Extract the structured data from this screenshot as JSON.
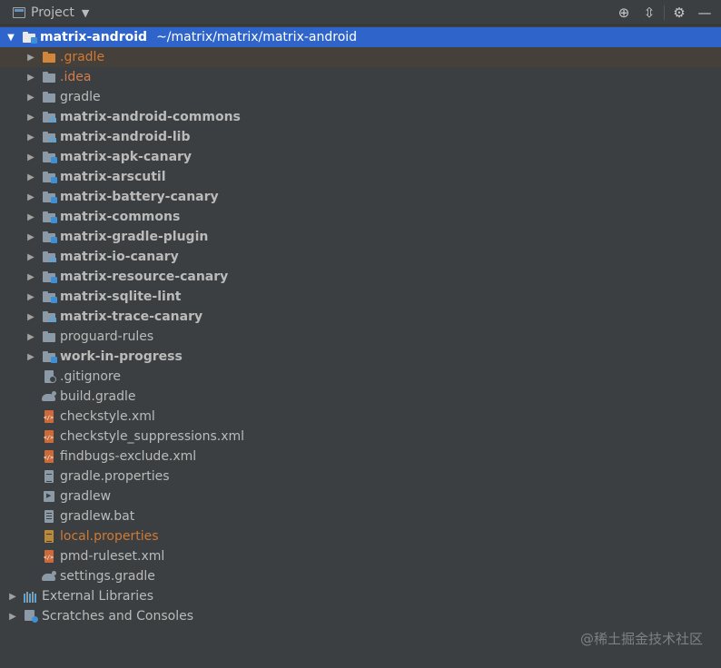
{
  "header": {
    "title": "Project",
    "tools": [
      {
        "name": "locate-icon",
        "glyph": "⊕"
      },
      {
        "name": "collapse-all-icon",
        "glyph": "⇳"
      },
      {
        "name": "gear-icon",
        "glyph": "⚙"
      },
      {
        "name": "hide-icon",
        "glyph": "—"
      }
    ]
  },
  "tree": {
    "root": {
      "label": "matrix-android",
      "path": "~/matrix/matrix/matrix-android"
    },
    "items": [
      {
        "label": ".gradle",
        "icon": "folder-orange"
      },
      {
        "label": ".idea",
        "icon": "folder"
      },
      {
        "label": "gradle",
        "icon": "folder"
      },
      {
        "label": "matrix-android-commons",
        "icon": "module-bars"
      },
      {
        "label": "matrix-android-lib",
        "icon": "module-bars"
      },
      {
        "label": "matrix-apk-canary",
        "icon": "module"
      },
      {
        "label": "matrix-arscutil",
        "icon": "module"
      },
      {
        "label": "matrix-battery-canary",
        "icon": "module"
      },
      {
        "label": "matrix-commons",
        "icon": "module"
      },
      {
        "label": "matrix-gradle-plugin",
        "icon": "module"
      },
      {
        "label": "matrix-io-canary",
        "icon": "module-bars"
      },
      {
        "label": "matrix-resource-canary",
        "icon": "module"
      },
      {
        "label": "matrix-sqlite-lint",
        "icon": "module"
      },
      {
        "label": "matrix-trace-canary",
        "icon": "module-bars"
      },
      {
        "label": "proguard-rules",
        "icon": "folder"
      },
      {
        "label": "work-in-progress",
        "icon": "module"
      }
    ],
    "files": [
      {
        "label": ".gitignore",
        "icon": "ignore"
      },
      {
        "label": "build.gradle",
        "icon": "gradle"
      },
      {
        "label": "checkstyle.xml",
        "icon": "xml"
      },
      {
        "label": "checkstyle_suppressions.xml",
        "icon": "xml"
      },
      {
        "label": "findbugs-exclude.xml",
        "icon": "xml"
      },
      {
        "label": "gradle.properties",
        "icon": "props"
      },
      {
        "label": "gradlew",
        "icon": "exe"
      },
      {
        "label": "gradlew.bat",
        "icon": "bat"
      },
      {
        "label": "local.properties",
        "icon": "props-modified"
      },
      {
        "label": "pmd-ruleset.xml",
        "icon": "xml"
      },
      {
        "label": "settings.gradle",
        "icon": "gradle"
      }
    ],
    "external_libraries": "External Libraries",
    "scratches": "Scratches and Consoles"
  },
  "watermark": "@稀土掘金技术社区",
  "colors": {
    "background": "#3c3f41",
    "selection": "#2f65ca",
    "excluded_text": "#d07a35",
    "module_badge": "#3d8fd6"
  }
}
